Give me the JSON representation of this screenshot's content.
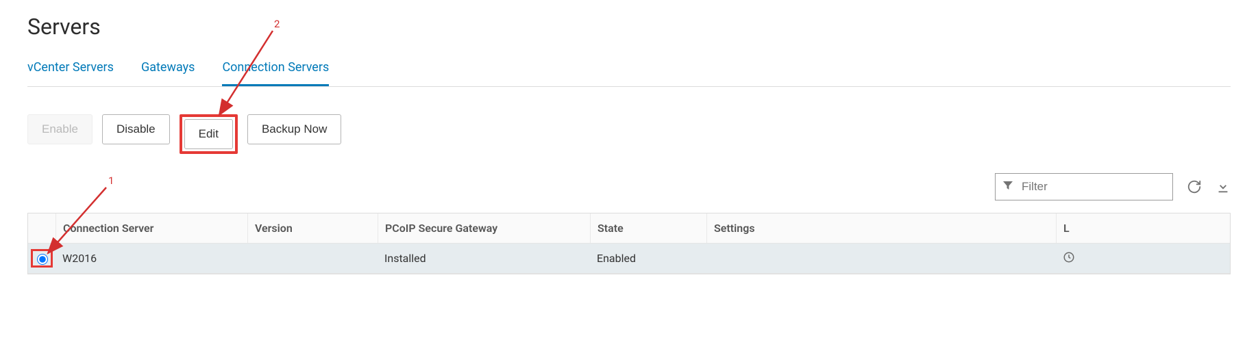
{
  "page_title": "Servers",
  "tabs": [
    {
      "label": "vCenter Servers",
      "active": false
    },
    {
      "label": "Gateways",
      "active": false
    },
    {
      "label": "Connection Servers",
      "active": true
    }
  ],
  "toolbar": {
    "enable_label": "Enable",
    "disable_label": "Disable",
    "edit_label": "Edit",
    "backup_now_label": "Backup Now"
  },
  "filter": {
    "placeholder": "Filter"
  },
  "columns": {
    "connection_server": "Connection Server",
    "version": "Version",
    "pcoip": "PCoIP Secure Gateway",
    "state": "State",
    "settings": "Settings",
    "last": "L"
  },
  "rows": [
    {
      "name": "W2016",
      "version": "",
      "pcoip": "Installed",
      "state": "Enabled",
      "settings": "",
      "selected": true
    }
  ],
  "annotations": {
    "label_1": "1",
    "label_2": "2",
    "highlight_color": "#e53935"
  }
}
